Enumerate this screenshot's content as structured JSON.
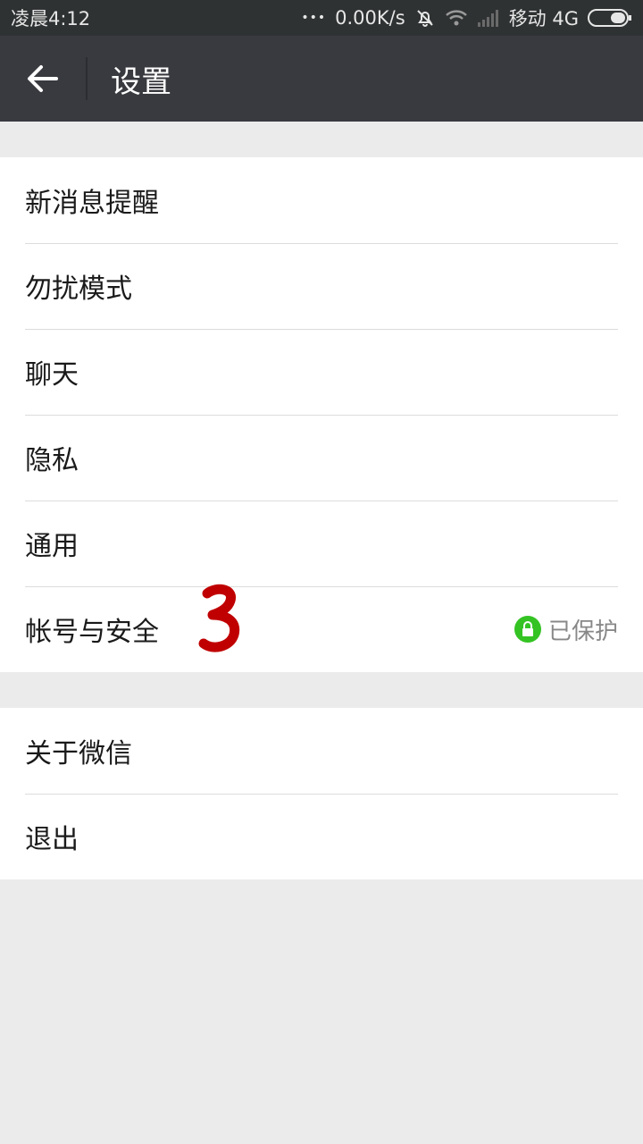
{
  "status_bar": {
    "time": "凌晨4:12",
    "dots": "•••",
    "net_speed": "0.00K/s",
    "carrier": "移动 4G",
    "icons": [
      "alarm-off-icon",
      "wifi-icon",
      "signal-icon",
      "battery-icon"
    ]
  },
  "header": {
    "title": "设置",
    "back_icon": "arrow-left-icon",
    "color": "#393a3f"
  },
  "settings": {
    "group1": [
      {
        "label": "新消息提醒"
      },
      {
        "label": "勿扰模式"
      },
      {
        "label": "聊天"
      },
      {
        "label": "隐私"
      },
      {
        "label": "通用"
      },
      {
        "label": "帐号与安全",
        "status": "已保护",
        "status_icon": "lock-icon",
        "status_color": "#34c323"
      }
    ],
    "group2": [
      {
        "label": "关于微信"
      },
      {
        "label": "退出"
      }
    ]
  },
  "annotation": {
    "text": "3",
    "color": "#c00000"
  }
}
